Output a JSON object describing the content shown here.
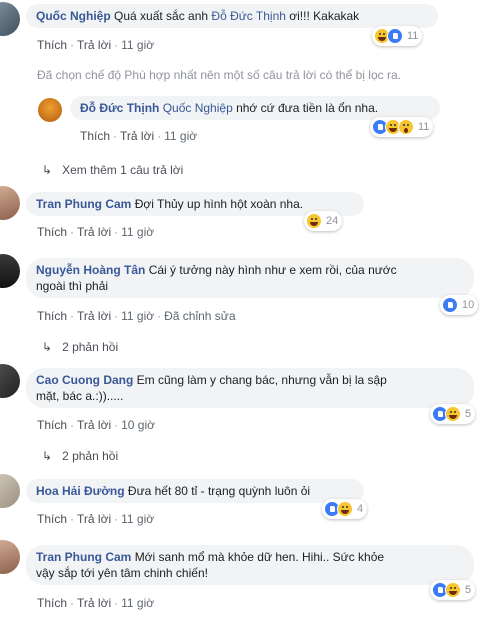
{
  "actions": {
    "like": "Thích",
    "reply": "Trả lời",
    "edited": "Đã chỉnh sửa"
  },
  "filter_note": "Đã chọn chế độ Phù hợp nhất nên một số câu trả lời có thể bị lọc ra.",
  "comments": [
    {
      "name": "Quốc Nghiệp",
      "text_before": "Quá xuất sắc anh ",
      "mention": "Đỗ Đức Thịnh",
      "text_after": " ơi!!! Kakakak",
      "time": "11 giờ",
      "reactions": [
        "haha",
        "like"
      ],
      "count": "11"
    },
    {
      "name": "Đỗ Đức Thịnh",
      "mention": "Quốc Nghiệp",
      "text_after": " nhớ cứ đưa tiền là ổn nha.",
      "time": "11 giờ",
      "reactions": [
        "like",
        "haha",
        "wow"
      ],
      "count": "11",
      "view_more": "Xem thêm 1 câu trả lời"
    },
    {
      "name": "Tran Phung Cam",
      "text": "Đợi Thủy up hình hột xoàn nha.",
      "time": "11 giờ",
      "reactions": [
        "haha"
      ],
      "count": "24"
    },
    {
      "name": "Nguyễn Hoàng Tân",
      "text_line1": "Cái ý tưởng này hình như e xem rồi, của nước",
      "text_line2": "ngoài thì phải",
      "time": "11 giờ",
      "reactions": [
        "like"
      ],
      "count": "10",
      "replies": "2 phản hồi"
    },
    {
      "name": "Cao Cuong Dang",
      "text_line1": "Em cũng làm y chang bác, nhưng vẫn bị la sập",
      "text_line2": "mặt, bác a.:)).....",
      "time": "10 giờ",
      "reactions": [
        "like",
        "haha"
      ],
      "count": "5",
      "replies": "2 phản hồi"
    },
    {
      "name": "Hoa Hải Đường",
      "text": "Đưa hết 80 tỉ - trạng quỳnh luôn ỏi",
      "time": "11 giờ",
      "reactions": [
        "like",
        "haha"
      ],
      "count": "4"
    },
    {
      "name": "Tran Phung Cam",
      "text_line1": "Mới sanh mổ mà khỏe dữ hen. Hihi.. Sức khỏe",
      "text_line2": "vậy sắp tới yên tâm chinh chiến!",
      "time": "11 giờ",
      "reactions": [
        "like",
        "haha"
      ],
      "count": "5"
    }
  ]
}
